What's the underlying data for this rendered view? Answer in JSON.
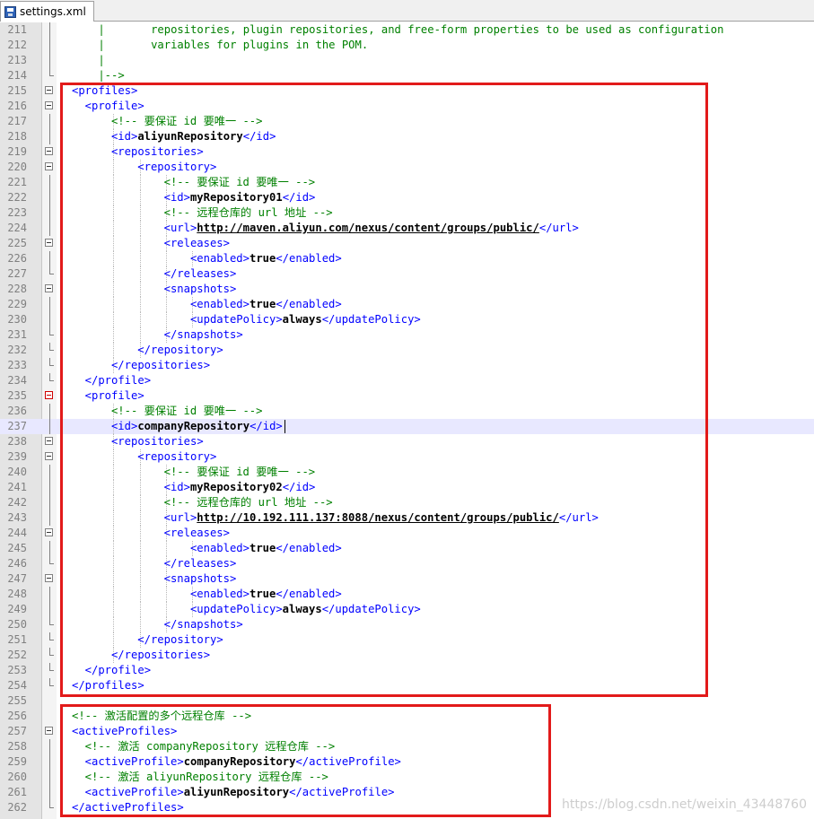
{
  "tab": {
    "filename": "settings.xml",
    "icon": "save-icon"
  },
  "lines": [
    {
      "n": "211",
      "indent": 0,
      "fold": "mid",
      "segments": [
        {
          "t": "p",
          "v": "    |       "
        },
        {
          "t": "c",
          "v": "repositories, plugin repositories, and free-form properties to be used as configuration"
        }
      ]
    },
    {
      "n": "212",
      "indent": 0,
      "fold": "mid",
      "segments": [
        {
          "t": "p",
          "v": "    |       "
        },
        {
          "t": "c",
          "v": "variables for plugins in the POM."
        }
      ]
    },
    {
      "n": "213",
      "indent": 0,
      "fold": "mid",
      "segments": [
        {
          "t": "p",
          "v": "    |"
        }
      ]
    },
    {
      "n": "214",
      "indent": 0,
      "fold": "end",
      "segments": [
        {
          "t": "p",
          "v": "    |-->"
        }
      ]
    },
    {
      "n": "215",
      "indent": 0,
      "fold": "box",
      "segments": [
        {
          "t": "t",
          "v": "<profiles>"
        }
      ]
    },
    {
      "n": "216",
      "indent": 1,
      "fold": "box",
      "segments": [
        {
          "t": "t",
          "v": "<profile>"
        }
      ]
    },
    {
      "n": "217",
      "indent": 3,
      "fold": "mid",
      "segments": [
        {
          "t": "c",
          "v": "<!-- 要保证 id 要唯一 -->"
        }
      ]
    },
    {
      "n": "218",
      "indent": 3,
      "fold": "mid",
      "segments": [
        {
          "t": "t",
          "v": "<id>"
        },
        {
          "t": "x",
          "v": "aliyunRepository"
        },
        {
          "t": "t",
          "v": "</id>"
        }
      ]
    },
    {
      "n": "219",
      "indent": 3,
      "fold": "box",
      "segments": [
        {
          "t": "t",
          "v": "<repositories>"
        }
      ]
    },
    {
      "n": "220",
      "indent": 5,
      "fold": "box",
      "segments": [
        {
          "t": "t",
          "v": "<repository>"
        }
      ]
    },
    {
      "n": "221",
      "indent": 7,
      "fold": "mid",
      "segments": [
        {
          "t": "c",
          "v": "<!-- 要保证 id 要唯一 -->"
        }
      ]
    },
    {
      "n": "222",
      "indent": 7,
      "fold": "mid",
      "segments": [
        {
          "t": "t",
          "v": "<id>"
        },
        {
          "t": "x",
          "v": "myRepository01"
        },
        {
          "t": "t",
          "v": "</id>"
        }
      ]
    },
    {
      "n": "223",
      "indent": 7,
      "fold": "mid",
      "segments": [
        {
          "t": "c",
          "v": "<!-- 远程仓库的 url 地址 -->"
        }
      ]
    },
    {
      "n": "224",
      "indent": 7,
      "fold": "mid",
      "segments": [
        {
          "t": "t",
          "v": "<url>"
        },
        {
          "t": "u",
          "v": "http://maven.aliyun.com/nexus/content/groups/public/"
        },
        {
          "t": "t",
          "v": "</url>"
        }
      ]
    },
    {
      "n": "225",
      "indent": 7,
      "fold": "box",
      "segments": [
        {
          "t": "t",
          "v": "<releases>"
        }
      ]
    },
    {
      "n": "226",
      "indent": 9,
      "fold": "mid",
      "segments": [
        {
          "t": "t",
          "v": "<enabled>"
        },
        {
          "t": "x",
          "v": "true"
        },
        {
          "t": "t",
          "v": "</enabled>"
        }
      ]
    },
    {
      "n": "227",
      "indent": 7,
      "fold": "end",
      "segments": [
        {
          "t": "t",
          "v": "</releases>"
        }
      ]
    },
    {
      "n": "228",
      "indent": 7,
      "fold": "box",
      "segments": [
        {
          "t": "t",
          "v": "<snapshots>"
        }
      ]
    },
    {
      "n": "229",
      "indent": 9,
      "fold": "mid",
      "segments": [
        {
          "t": "t",
          "v": "<enabled>"
        },
        {
          "t": "x",
          "v": "true"
        },
        {
          "t": "t",
          "v": "</enabled>"
        }
      ]
    },
    {
      "n": "230",
      "indent": 9,
      "fold": "mid",
      "segments": [
        {
          "t": "t",
          "v": "<updatePolicy>"
        },
        {
          "t": "x",
          "v": "always"
        },
        {
          "t": "t",
          "v": "</updatePolicy>"
        }
      ]
    },
    {
      "n": "231",
      "indent": 7,
      "fold": "end",
      "segments": [
        {
          "t": "t",
          "v": "</snapshots>"
        }
      ]
    },
    {
      "n": "232",
      "indent": 5,
      "fold": "end",
      "segments": [
        {
          "t": "t",
          "v": "</repository>"
        }
      ]
    },
    {
      "n": "233",
      "indent": 3,
      "fold": "end",
      "segments": [
        {
          "t": "t",
          "v": "</repositories>"
        }
      ]
    },
    {
      "n": "234",
      "indent": 1,
      "fold": "end",
      "segments": [
        {
          "t": "t",
          "v": "</profile>"
        }
      ]
    },
    {
      "n": "235",
      "indent": 1,
      "fold": "boxred",
      "segments": [
        {
          "t": "t",
          "v": "<profile>"
        }
      ]
    },
    {
      "n": "236",
      "indent": 3,
      "fold": "mid",
      "segments": [
        {
          "t": "c",
          "v": "<!-- 要保证 id 要唯一 -->"
        }
      ]
    },
    {
      "n": "237",
      "indent": 3,
      "fold": "mid",
      "current": true,
      "segments": [
        {
          "t": "t",
          "v": "<id>"
        },
        {
          "t": "x",
          "v": "companyRepository"
        },
        {
          "t": "t",
          "v": "</id>"
        }
      ]
    },
    {
      "n": "238",
      "indent": 3,
      "fold": "box",
      "segments": [
        {
          "t": "t",
          "v": "<repositories>"
        }
      ]
    },
    {
      "n": "239",
      "indent": 5,
      "fold": "box",
      "segments": [
        {
          "t": "t",
          "v": "<repository>"
        }
      ]
    },
    {
      "n": "240",
      "indent": 7,
      "fold": "mid",
      "segments": [
        {
          "t": "c",
          "v": "<!-- 要保证 id 要唯一 -->"
        }
      ]
    },
    {
      "n": "241",
      "indent": 7,
      "fold": "mid",
      "segments": [
        {
          "t": "t",
          "v": "<id>"
        },
        {
          "t": "x",
          "v": "myRepository02"
        },
        {
          "t": "t",
          "v": "</id>"
        }
      ]
    },
    {
      "n": "242",
      "indent": 7,
      "fold": "mid",
      "segments": [
        {
          "t": "c",
          "v": "<!-- 远程仓库的 url 地址 -->"
        }
      ]
    },
    {
      "n": "243",
      "indent": 7,
      "fold": "mid",
      "segments": [
        {
          "t": "t",
          "v": "<url>"
        },
        {
          "t": "u",
          "v": "http://10.192.111.137:8088/nexus/content/groups/public/"
        },
        {
          "t": "t",
          "v": "</url>"
        }
      ]
    },
    {
      "n": "244",
      "indent": 7,
      "fold": "box",
      "segments": [
        {
          "t": "t",
          "v": "<releases>"
        }
      ]
    },
    {
      "n": "245",
      "indent": 9,
      "fold": "mid",
      "segments": [
        {
          "t": "t",
          "v": "<enabled>"
        },
        {
          "t": "x",
          "v": "true"
        },
        {
          "t": "t",
          "v": "</enabled>"
        }
      ]
    },
    {
      "n": "246",
      "indent": 7,
      "fold": "end",
      "segments": [
        {
          "t": "t",
          "v": "</releases>"
        }
      ]
    },
    {
      "n": "247",
      "indent": 7,
      "fold": "box",
      "segments": [
        {
          "t": "t",
          "v": "<snapshots>"
        }
      ]
    },
    {
      "n": "248",
      "indent": 9,
      "fold": "mid",
      "segments": [
        {
          "t": "t",
          "v": "<enabled>"
        },
        {
          "t": "x",
          "v": "true"
        },
        {
          "t": "t",
          "v": "</enabled>"
        }
      ]
    },
    {
      "n": "249",
      "indent": 9,
      "fold": "mid",
      "segments": [
        {
          "t": "t",
          "v": "<updatePolicy>"
        },
        {
          "t": "x",
          "v": "always"
        },
        {
          "t": "t",
          "v": "</updatePolicy>"
        }
      ]
    },
    {
      "n": "250",
      "indent": 7,
      "fold": "end",
      "segments": [
        {
          "t": "t",
          "v": "</snapshots>"
        }
      ]
    },
    {
      "n": "251",
      "indent": 5,
      "fold": "end",
      "segments": [
        {
          "t": "t",
          "v": "</repository>"
        }
      ]
    },
    {
      "n": "252",
      "indent": 3,
      "fold": "end",
      "segments": [
        {
          "t": "t",
          "v": "</repositories>"
        }
      ]
    },
    {
      "n": "253",
      "indent": 1,
      "fold": "end",
      "segments": [
        {
          "t": "t",
          "v": "</profile>"
        }
      ]
    },
    {
      "n": "254",
      "indent": 0,
      "fold": "end",
      "segments": [
        {
          "t": "t",
          "v": "</profiles>"
        }
      ]
    },
    {
      "n": "255",
      "indent": 0,
      "fold": "none",
      "segments": []
    },
    {
      "n": "256",
      "indent": 0,
      "fold": "none",
      "segments": [
        {
          "t": "c",
          "v": "<!-- 激活配置的多个远程仓库 -->"
        }
      ]
    },
    {
      "n": "257",
      "indent": 0,
      "fold": "box",
      "segments": [
        {
          "t": "t",
          "v": "<activeProfiles>"
        }
      ]
    },
    {
      "n": "258",
      "indent": 1,
      "fold": "mid",
      "segments": [
        {
          "t": "c",
          "v": "<!-- 激活 companyRepository 远程仓库 -->"
        }
      ]
    },
    {
      "n": "259",
      "indent": 1,
      "fold": "mid",
      "segments": [
        {
          "t": "t",
          "v": "<activeProfile>"
        },
        {
          "t": "x",
          "v": "companyRepository"
        },
        {
          "t": "t",
          "v": "</activeProfile>"
        }
      ]
    },
    {
      "n": "260",
      "indent": 1,
      "fold": "mid",
      "segments": [
        {
          "t": "c",
          "v": "<!-- 激活 aliyunRepository 远程仓库 -->"
        }
      ]
    },
    {
      "n": "261",
      "indent": 1,
      "fold": "mid",
      "segments": [
        {
          "t": "t",
          "v": "<activeProfile>"
        },
        {
          "t": "x",
          "v": "aliyunRepository"
        },
        {
          "t": "t",
          "v": "</activeProfile>"
        }
      ]
    },
    {
      "n": "262",
      "indent": 0,
      "fold": "end",
      "segments": [
        {
          "t": "t",
          "v": "</activeProfiles>"
        }
      ]
    }
  ],
  "watermark": "https://blog.csdn.net/weixin_43448760",
  "colors": {
    "tag": "#0000ff",
    "comment": "#008000",
    "highlight_box": "#e21a1a",
    "current_line": "#e8e8ff"
  }
}
